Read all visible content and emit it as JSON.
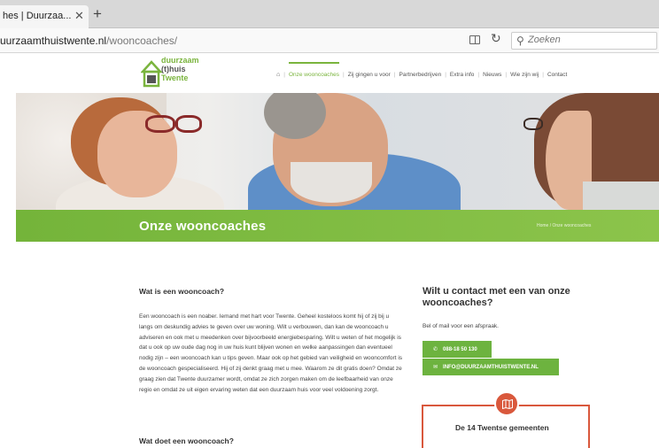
{
  "browser": {
    "tab_title": "hes | Duurzaa...",
    "tab_close": "✕",
    "new_tab": "+",
    "url_domain": "uurzaamthuistwente.nl",
    "url_path": "/wooncoaches/",
    "reload": "↻",
    "search_glyph": "⚲",
    "search_placeholder": "Zoeken"
  },
  "site": {
    "logo": {
      "line1": "duurzaam",
      "line2": "(t)huis",
      "line3": "Twente"
    },
    "menu": {
      "home": "⌂",
      "items": [
        "Onze wooncoaches",
        "Zij gingen u voor",
        "Partnerbedrijven",
        "Extra info",
        "Nieuws",
        "Wie zijn wij",
        "Contact"
      ]
    },
    "page_title": "Onze wooncoaches",
    "breadcrumb": "Home / Onze wooncoaches"
  },
  "main": {
    "heading1": "Wat is een wooncoach?",
    "paragraph": "Een wooncoach is een noaber. Iemand met hart voor Twente. Geheel kosteloos komt hij of zij bij u langs om deskundig advies te geven over uw woning. Wilt u verbouwen, dan kan de wooncoach u adviseren en ook met u meedenken over bijvoorbeeld energiebesparing. Wilt u weten of het mogelijk is dat u ook op uw oude dag nog in uw huis kunt blijven wonen en welke aanpassingen dan eventueel nodig zijn – een wooncoach kan u tips geven. Maar ook op het gebied van veiligheid en wooncomfort is de wooncoach gespecialiseerd. Hij of zij denkt graag met u mee. Waarom ze dit gratis doen? Omdat ze graag zien dat Twente duurzamer wordt, omdat ze zich zorgen maken om de leefbaarheid van onze regio en omdat ze uit eigen ervaring weten dat een duurzaam huis voor veel voldoening zorgt.",
    "heading2": "Wat doet een wooncoach?"
  },
  "sidebar": {
    "title": "Wilt u contact met een van onze wooncoaches?",
    "text": "Bel of mail voor een afspraak.",
    "phone_icon": "✆",
    "phone": "088-18 50 130",
    "mail_icon": "✉",
    "email": "INFO@DUURZAAMTHUISTWENTE.NL",
    "widget_title": "De 14 Twentse gemeenten"
  },
  "colors": {
    "brand_green": "#74b43a",
    "accent_orange": "#d9583c"
  }
}
